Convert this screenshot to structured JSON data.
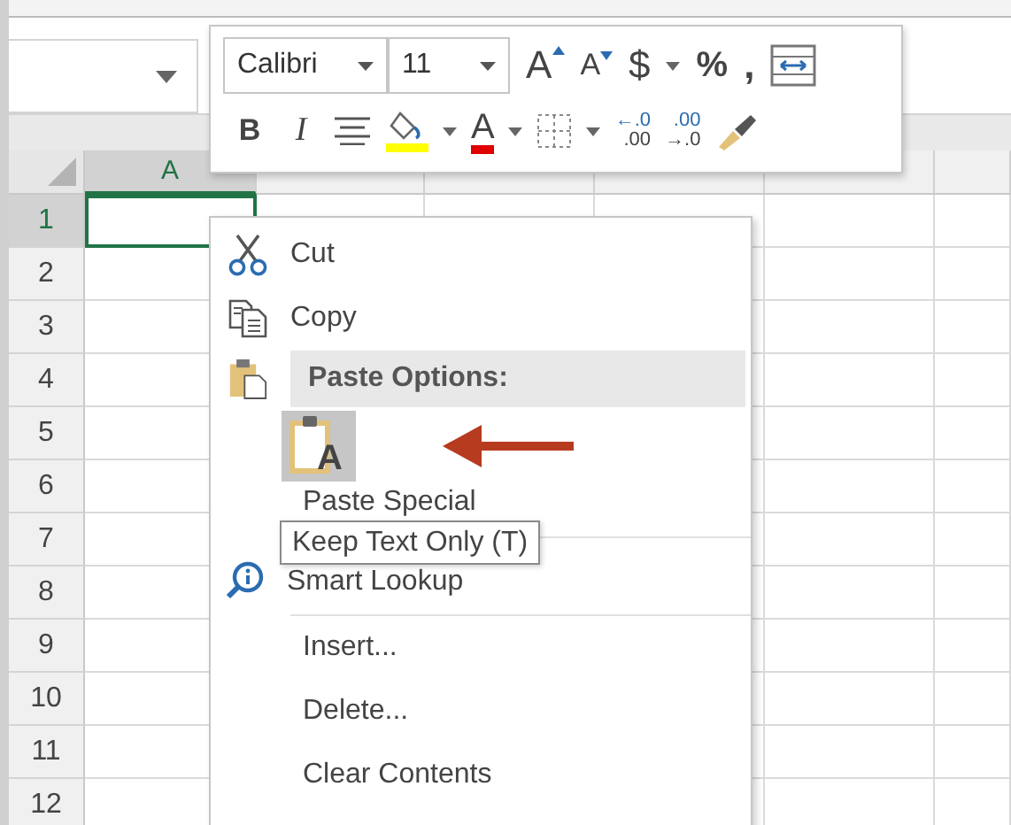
{
  "columns": [
    {
      "label": "A",
      "selected": true
    },
    {
      "selected": false
    },
    {
      "selected": false
    },
    {
      "selected": false
    },
    {
      "selected": false
    },
    {
      "selected": false
    }
  ],
  "rows": [
    {
      "label": "1",
      "selected": true
    },
    {
      "label": "2",
      "selected": false
    },
    {
      "label": "3",
      "selected": false
    },
    {
      "label": "4",
      "selected": false
    },
    {
      "label": "5",
      "selected": false
    },
    {
      "label": "6",
      "selected": false
    },
    {
      "label": "7",
      "selected": false
    },
    {
      "label": "8",
      "selected": false
    },
    {
      "label": "9",
      "selected": false
    },
    {
      "label": "10",
      "selected": false
    },
    {
      "label": "11",
      "selected": false
    },
    {
      "label": "12",
      "selected": false
    }
  ],
  "mini_toolbar": {
    "font": "Calibri",
    "font_size": "11",
    "grow_font": "A",
    "shrink_font": "A",
    "currency": "$",
    "percent": "%",
    "comma": ",",
    "bold": "B",
    "italic": "I",
    "font_color": "A",
    "increase_decimal": [
      "←.0",
      ".00"
    ],
    "decrease_decimal": [
      ".00",
      "→.0"
    ]
  },
  "context_menu": {
    "items": [
      {
        "kind": "cut",
        "label": "Cut",
        "separator_after": false
      },
      {
        "kind": "copy",
        "label": "Copy",
        "separator_after": false
      },
      {
        "kind": "header",
        "label": "Paste Options:",
        "separator_after": false
      },
      {
        "kind": "paste_options",
        "options": [
          {
            "glyph": "A",
            "selected": true
          }
        ],
        "separator_after": false
      },
      {
        "kind": "plain",
        "label": "Paste Special",
        "separator_after": true
      },
      {
        "kind": "lookup",
        "label": "Smart Lookup",
        "separator_after": true
      },
      {
        "kind": "plain",
        "label": "Insert...",
        "separator_after": false
      },
      {
        "kind": "plain",
        "label": "Delete...",
        "separator_after": false
      },
      {
        "kind": "plain",
        "label": "Clear Contents",
        "separator_after": false
      }
    ]
  },
  "tooltip": {
    "text": "Keep Text Only (T)"
  }
}
